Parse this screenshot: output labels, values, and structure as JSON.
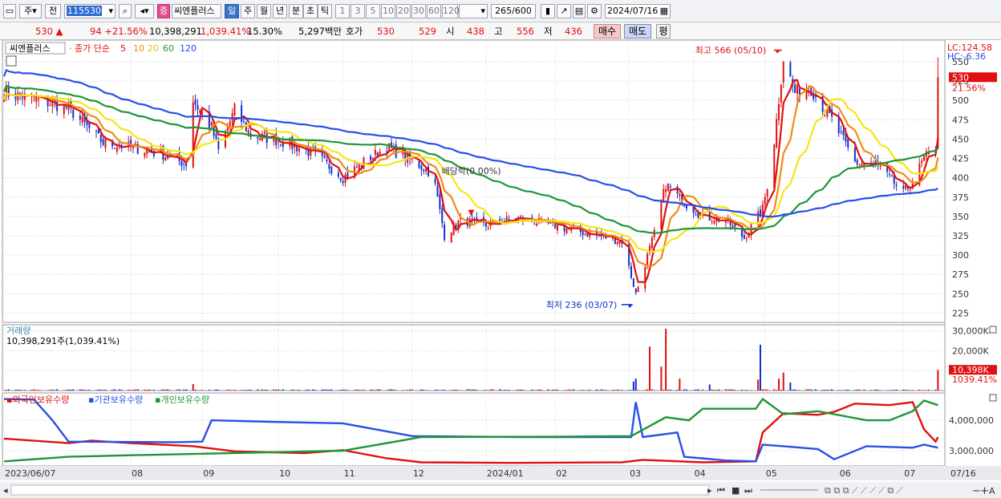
{
  "toolbar": {
    "period_type": "주",
    "prev_label": "전",
    "stock_code": "115530",
    "stock_name": "씨엔플러스",
    "stock_tag": "증",
    "intervals": [
      "일",
      "주",
      "월",
      "년",
      "분",
      "초",
      "틱"
    ],
    "selected_interval": "일",
    "ranges": [
      "1",
      "3",
      "5",
      "10",
      "20",
      "30",
      "60",
      "120"
    ],
    "count_value": "265",
    "count_total": "/600",
    "date": "2024/07/16"
  },
  "info": {
    "price": "530",
    "change_arrow": "▲",
    "change": "94",
    "change_pct": "+21.56%",
    "volume": "10,398,291",
    "volume_ratio": "1,039.41%",
    "turnover": "15.30%",
    "trade_value": "5,297백만",
    "quote_label": "호가",
    "ask": "530",
    "bid": "529",
    "open_label": "시",
    "open": "438",
    "high_label": "고",
    "high": "556",
    "low_label": "저",
    "low": "436",
    "buy_label": "매수",
    "sell_label": "매도",
    "avg_label": "평"
  },
  "legend": {
    "name": "씨엔플러스",
    "ma_prefix": "종가 단순",
    "ma_periods": [
      "5",
      "10",
      "20",
      "60",
      "120"
    ],
    "ma_colors": [
      "#e01010",
      "#f08c14",
      "#f5e614",
      "#1e9637",
      "#2850e6"
    ]
  },
  "labels": {
    "lc": "LC:124.58",
    "hc": "HC:-6.36",
    "price_marker": "530",
    "price_pct": "21.56%",
    "high_annot": "최고 566 (05/10)",
    "low_annot": "최저 236 (03/07)",
    "dividend_annot": "배당락(0.00%)",
    "volume_title": "거래량",
    "volume_value": "10,398,291주(1,039.41%)",
    "volume_marker": "10,398K",
    "volume_pct": "1039.41%",
    "holdings_title_1": "외국인보유수량",
    "holdings_title_2": "기관보유수량",
    "holdings_title_3": "개인보유수량",
    "last_date": "07/16"
  },
  "chart_data": [
    {
      "type": "candlestick",
      "title": "씨엔플러스",
      "y_ticks": [
        225,
        250,
        275,
        300,
        325,
        350,
        375,
        400,
        425,
        450,
        475,
        500,
        525,
        550
      ],
      "ylim": [
        213,
        578
      ],
      "x_tick_labels": [
        "2023/06/07",
        "08",
        "09",
        "10",
        "11",
        "12",
        "2024/01",
        "02",
        "03",
        "04",
        "05",
        "06",
        "07"
      ],
      "x_tick_dates": [
        "2023-06-07",
        "2023-08-01",
        "2023-09-01",
        "2023-10-04",
        "2023-11-01",
        "2023-12-01",
        "2024-01-02",
        "2024-02-01",
        "2024-03-04",
        "2024-04-01",
        "2024-05-02",
        "2024-06-03",
        "2024-07-01"
      ],
      "close_path": [
        [
          "2023-06-07",
          510
        ],
        [
          "2023-06-20",
          502
        ],
        [
          "2023-07-05",
          490
        ],
        [
          "2023-07-20",
          445
        ],
        [
          "2023-08-01",
          440
        ],
        [
          "2023-08-15",
          430
        ],
        [
          "2023-08-25",
          418
        ],
        [
          "2023-08-28",
          500
        ],
        [
          "2023-09-05",
          465
        ],
        [
          "2023-09-08",
          435
        ],
        [
          "2023-09-15",
          488
        ],
        [
          "2023-09-22",
          455
        ],
        [
          "2023-10-05",
          448
        ],
        [
          "2023-10-20",
          430
        ],
        [
          "2023-11-01",
          400
        ],
        [
          "2023-11-10",
          420
        ],
        [
          "2023-11-20",
          440
        ],
        [
          "2023-12-01",
          422
        ],
        [
          "2023-12-10",
          405
        ],
        [
          "2023-12-15",
          325
        ],
        [
          "2023-12-22",
          345
        ],
        [
          "2024-01-02",
          338
        ],
        [
          "2024-01-15",
          348
        ],
        [
          "2024-02-01",
          338
        ],
        [
          "2024-02-15",
          328
        ],
        [
          "2024-03-01",
          318
        ],
        [
          "2024-03-07",
          250
        ],
        [
          "2024-03-15",
          328
        ],
        [
          "2024-03-20",
          392
        ],
        [
          "2024-03-28",
          368
        ],
        [
          "2024-04-05",
          350
        ],
        [
          "2024-04-15",
          345
        ],
        [
          "2024-04-23",
          322
        ],
        [
          "2024-05-01",
          360
        ],
        [
          "2024-05-05",
          420
        ],
        [
          "2024-05-10",
          555
        ],
        [
          "2024-05-15",
          510
        ],
        [
          "2024-05-22",
          515
        ],
        [
          "2024-06-01",
          470
        ],
        [
          "2024-06-10",
          420
        ],
        [
          "2024-06-20",
          415
        ],
        [
          "2024-07-01",
          380
        ],
        [
          "2024-07-05",
          395
        ],
        [
          "2024-07-10",
          425
        ],
        [
          "2024-07-15",
          436
        ],
        [
          "2024-07-16",
          530
        ]
      ],
      "last_candle": {
        "date": "2024-07-16",
        "open": 438,
        "high": 556,
        "low": 436,
        "close": 530
      },
      "high_point": {
        "date": "2024-05-10",
        "value": 566
      },
      "low_point": {
        "date": "2024-03-07",
        "value": 236
      },
      "dividend_date": "2023-12-27",
      "series": [
        {
          "name": "5",
          "color": "#e01010"
        },
        {
          "name": "10",
          "color": "#f08c14"
        },
        {
          "name": "20",
          "color": "#f5e614"
        },
        {
          "name": "60",
          "color": "#1e9637"
        },
        {
          "name": "120",
          "color": "#2850e6"
        }
      ]
    },
    {
      "type": "bar",
      "title": "거래량",
      "y_ticks": [
        10000,
        20000,
        30000
      ],
      "y_tick_labels": [
        "10,000K",
        "20,000K",
        "30,000K"
      ],
      "ylim": [
        0,
        33000
      ],
      "spikes": [
        {
          "date": "2023-08-28",
          "value": 3200
        },
        {
          "date": "2024-01-20",
          "value": 1800
        },
        {
          "date": "2024-03-06",
          "value": 4500
        },
        {
          "date": "2024-03-07",
          "value": 6000
        },
        {
          "date": "2024-03-13",
          "value": 22000
        },
        {
          "date": "2024-03-18",
          "value": 12000
        },
        {
          "date": "2024-03-20",
          "value": 31000
        },
        {
          "date": "2024-03-26",
          "value": 6000
        },
        {
          "date": "2024-04-08",
          "value": 3000
        },
        {
          "date": "2024-04-29",
          "value": 5500
        },
        {
          "date": "2024-04-30",
          "value": 23000
        },
        {
          "date": "2024-05-08",
          "value": 6000
        },
        {
          "date": "2024-05-10",
          "value": 9000
        },
        {
          "date": "2024-05-13",
          "value": 4000
        },
        {
          "date": "2024-07-16",
          "value": 10398
        }
      ]
    },
    {
      "type": "line",
      "title": "외국인보유수량 / 기관보유수량 / 개인보유수량",
      "y_ticks": [
        3000000,
        4000000
      ],
      "y_tick_labels": [
        "3,000,000",
        "4,000,000"
      ],
      "ylim": [
        2500000,
        4900000
      ],
      "series": [
        {
          "name": "외국인보유수량",
          "color": "#e01010",
          "points": [
            [
              "2023-06-07",
              3400000
            ],
            [
              "2023-07-05",
              3250000
            ],
            [
              "2023-07-15",
              3330000
            ],
            [
              "2023-08-01",
              3250000
            ],
            [
              "2023-08-28",
              3150000
            ],
            [
              "2023-09-15",
              2980000
            ],
            [
              "2023-10-15",
              2920000
            ],
            [
              "2023-11-01",
              3020000
            ],
            [
              "2023-11-20",
              2750000
            ],
            [
              "2023-12-05",
              2620000
            ],
            [
              "2024-01-15",
              2600000
            ],
            [
              "2024-03-01",
              2620000
            ],
            [
              "2024-03-10",
              2700000
            ],
            [
              "2024-04-05",
              2620000
            ],
            [
              "2024-04-28",
              2650000
            ],
            [
              "2024-05-01",
              3600000
            ],
            [
              "2024-05-10",
              4230000
            ],
            [
              "2024-05-25",
              4180000
            ],
            [
              "2024-06-01",
              4280000
            ],
            [
              "2024-06-10",
              4550000
            ],
            [
              "2024-06-25",
              4500000
            ],
            [
              "2024-07-05",
              4600000
            ],
            [
              "2024-07-10",
              3700000
            ],
            [
              "2024-07-15",
              3300000
            ],
            [
              "2024-07-16",
              3450000
            ]
          ]
        },
        {
          "name": "기관보유수량",
          "color": "#2850e6",
          "points": [
            [
              "2023-06-07",
              4700000
            ],
            [
              "2023-06-20",
              4680000
            ],
            [
              "2023-06-28",
              4000000
            ],
            [
              "2023-07-05",
              3300000
            ],
            [
              "2023-08-20",
              3280000
            ],
            [
              "2023-09-01",
              3300000
            ],
            [
              "2023-09-05",
              4000000
            ],
            [
              "2023-10-01",
              3950000
            ],
            [
              "2023-11-01",
              3900000
            ],
            [
              "2023-12-01",
              3480000
            ],
            [
              "2024-01-15",
              3450000
            ],
            [
              "2024-02-15",
              3450000
            ],
            [
              "2024-03-05",
              3450000
            ],
            [
              "2024-03-07",
              4600000
            ],
            [
              "2024-03-10",
              3450000
            ],
            [
              "2024-03-25",
              3600000
            ],
            [
              "2024-03-28",
              2800000
            ],
            [
              "2024-04-15",
              2680000
            ],
            [
              "2024-04-28",
              2650000
            ],
            [
              "2024-05-01",
              3200000
            ],
            [
              "2024-05-10",
              3150000
            ],
            [
              "2024-05-25",
              3050000
            ],
            [
              "2024-06-01",
              2720000
            ],
            [
              "2024-06-15",
              3150000
            ],
            [
              "2024-07-05",
              3100000
            ],
            [
              "2024-07-10",
              3200000
            ],
            [
              "2024-07-16",
              3100000
            ]
          ]
        },
        {
          "name": "개인보유수량",
          "color": "#1e9637",
          "points": [
            [
              "2023-06-07",
              2650000
            ],
            [
              "2023-07-05",
              2800000
            ],
            [
              "2023-08-01",
              2850000
            ],
            [
              "2023-09-01",
              2900000
            ],
            [
              "2023-10-01",
              2950000
            ],
            [
              "2023-11-01",
              3000000
            ],
            [
              "2023-12-05",
              3450000
            ],
            [
              "2024-02-01",
              3460000
            ],
            [
              "2024-03-05",
              3480000
            ],
            [
              "2024-03-20",
              4100000
            ],
            [
              "2024-03-30",
              4000000
            ],
            [
              "2024-04-05",
              4380000
            ],
            [
              "2024-04-28",
              4380000
            ],
            [
              "2024-05-01",
              4700000
            ],
            [
              "2024-05-10",
              4200000
            ],
            [
              "2024-05-25",
              4300000
            ],
            [
              "2024-06-01",
              4200000
            ],
            [
              "2024-06-15",
              4000000
            ],
            [
              "2024-06-25",
              4000000
            ],
            [
              "2024-07-05",
              4300000
            ],
            [
              "2024-07-10",
              4650000
            ],
            [
              "2024-07-16",
              4500000
            ]
          ]
        }
      ]
    }
  ]
}
